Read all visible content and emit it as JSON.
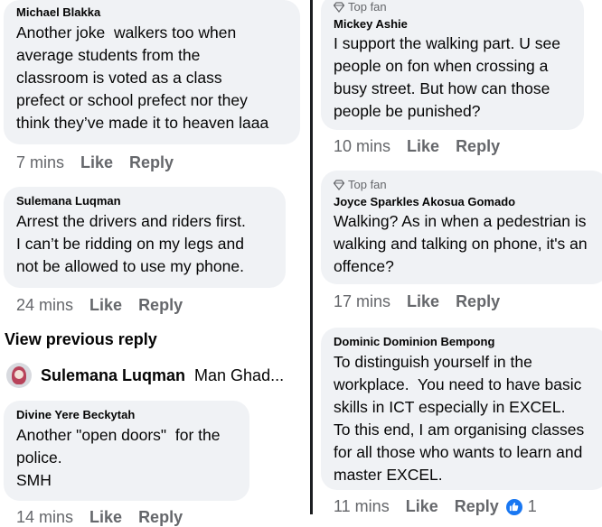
{
  "left_column": {
    "comments": [
      {
        "author": "Michael Blakka",
        "text": "Another joke  walkers too when\naverage students from the\nclassroom is voted as a class\nprefect or school prefect nor they\nthink they’ve made it to heaven laaa",
        "time": "7 mins",
        "like_label": "Like",
        "reply_label": "Reply"
      },
      {
        "author": "Sulemana Luqman",
        "text": "Arrest the drivers and riders first.\nI can’t be ridding on my legs and\nnot be allowed to use my phone.",
        "time": "24 mins",
        "like_label": "Like",
        "reply_label": "Reply"
      },
      {
        "author": "Divine Yere Beckytah",
        "text": "Another \"open doors\"  for the\npolice.\nSMH",
        "time": "14 mins",
        "like_label": "Like",
        "reply_label": "Reply"
      }
    ],
    "view_previous_reply": "View previous reply",
    "reply_preview": {
      "name": "Sulemana Luqman",
      "snippet": "Man Ghad..."
    }
  },
  "right_column": {
    "comments": [
      {
        "badge": "Top fan",
        "author": "Mickey Ashie",
        "text": "I support the walking part. U see\npeople on fon when crossing a\nbusy street. But how can those\npeople be punished?",
        "time": "10 mins",
        "like_label": "Like",
        "reply_label": "Reply"
      },
      {
        "badge": "Top fan",
        "author": "Joyce Sparkles Akosua Gomado",
        "text": "Walking? As in when a pedestrian is\nwalking and talking on phone, it's an\noffence?",
        "time": "17 mins",
        "like_label": "Like",
        "reply_label": "Reply"
      },
      {
        "author": "Dominic Dominion Bempong",
        "text": "To distinguish yourself in the\nworkplace.  You need to have basic\nskills in ICT especially in EXCEL.\nTo this end, I am organising classes\nfor all those who wants to learn and\nmaster EXCEL.",
        "time": "11 mins",
        "like_label": "Like",
        "reply_label": "Reply",
        "reaction_count": "1"
      }
    ]
  },
  "colors": {
    "bubble": "#f0f2f5",
    "meta_text": "#65676b",
    "like_blue": "#1877f2",
    "divider": "#1c1e21"
  }
}
